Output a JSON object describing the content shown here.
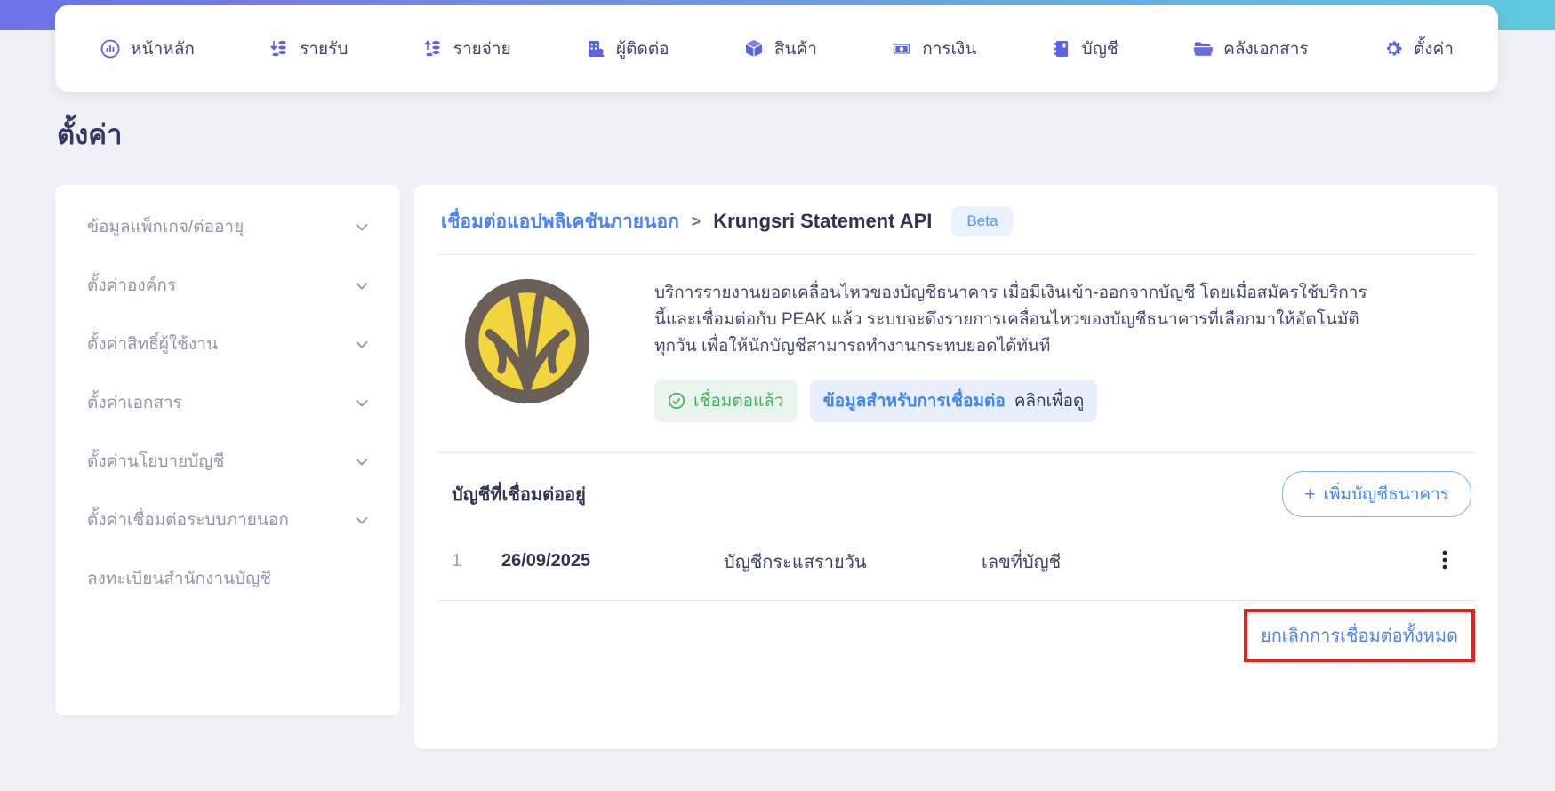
{
  "nav": {
    "items": [
      {
        "label": "หน้าหลัก",
        "icon": "dashboard-icon"
      },
      {
        "label": "รายรับ",
        "icon": "income-icon"
      },
      {
        "label": "รายจ่าย",
        "icon": "expense-icon"
      },
      {
        "label": "ผู้ติดต่อ",
        "icon": "contacts-icon"
      },
      {
        "label": "สินค้า",
        "icon": "products-icon"
      },
      {
        "label": "การเงิน",
        "icon": "finance-icon"
      },
      {
        "label": "บัญชี",
        "icon": "accounting-icon"
      },
      {
        "label": "คลังเอกสาร",
        "icon": "documents-icon"
      },
      {
        "label": "ตั้งค่า",
        "icon": "settings-icon"
      }
    ]
  },
  "page": {
    "title": "ตั้งค่า"
  },
  "sidebar": {
    "items": [
      {
        "label": "ข้อมูลแพ็กเกจ/ต่ออายุ",
        "expandable": true
      },
      {
        "label": "ตั้งค่าองค์กร",
        "expandable": true
      },
      {
        "label": "ตั้งค่าสิทธิ์ผู้ใช้งาน",
        "expandable": true
      },
      {
        "label": "ตั้งค่าเอกสาร",
        "expandable": true
      },
      {
        "label": "ตั้งค่านโยบายบัญชี",
        "expandable": true
      },
      {
        "label": "ตั้งค่าเชื่อมต่อระบบภายนอก",
        "expandable": true
      },
      {
        "label": "ลงทะเบียนสำนักงานบัญชี",
        "expandable": false
      }
    ]
  },
  "main": {
    "breadcrumb": {
      "parent": "เชื่อมต่อแอปพลิเคชันภายนอก",
      "separator": ">",
      "current": "Krungsri Statement API",
      "badge": "Beta"
    },
    "logo": "krungsri-bank-logo",
    "description": "บริการรายงานยอดเคลื่อนไหวของบัญชีธนาคาร เมื่อมีเงินเข้า-ออกจากบัญชี โดยเมื่อสมัครใช้บริการนี้และเชื่อมต่อกับ PEAK แล้ว ระบบจะดึงรายการเคลื่อนไหวของบัญชีธนาคารที่เลือกมาให้อัตโนมัติทุกวัน เพื่อให้นักบัญชีสามารถทำงานกระทบยอดได้ทันที",
    "status": {
      "connected_label": "เชื่อมต่อแล้ว",
      "info_label": "ข้อมูลสำหรับการเชื่อมต่อ",
      "info_action": "คลิกเพื่อดู"
    },
    "accounts": {
      "section_title": "บัญชีที่เชื่อมต่ออยู่",
      "add_button_label": "เพิ่มบัญชีธนาคาร",
      "add_button_plus": "+",
      "rows": [
        {
          "index": "1",
          "date": "26/09/2025",
          "account_type": "บัญชีกระแสรายวัน",
          "account_number_label": "เลขที่บัญชี"
        }
      ],
      "cancel_all_label": "ยกเลิกการเชื่อมต่อทั้งหมด"
    }
  },
  "colors": {
    "accent_indigo": "#5b63e4",
    "link_blue": "#4b82f7",
    "connected_green": "#3fae5b",
    "annotation_red": "#e8211d",
    "gradient_left": "#6b74e8",
    "gradient_right": "#5fc9de",
    "krungsri_brown": "#6b6057",
    "krungsri_yellow": "#f2d43c"
  }
}
